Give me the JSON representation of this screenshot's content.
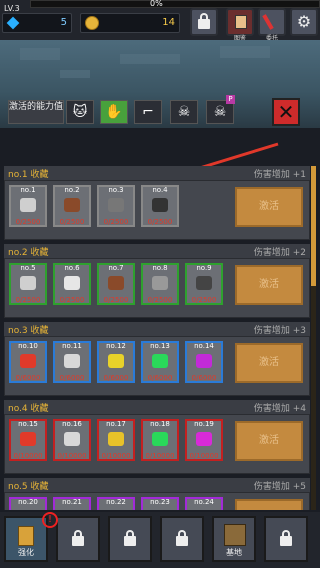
{
  "header": {
    "level": "LV.3",
    "xp_percent_text": "0%",
    "gems": "5",
    "coins": "14",
    "buttons": [
      {
        "label": ""
      },
      {
        "label": "图鉴"
      },
      {
        "label": "委托"
      },
      {
        "label": ""
      }
    ]
  },
  "tabs": {
    "text_tab": "激活的能力值",
    "icons": [
      "cat-icon",
      "hand-icon",
      "gun-icon",
      "skull-icon",
      "skull-p-icon"
    ],
    "p_badge": "P"
  },
  "groups": [
    {
      "name": "no.1 收藏",
      "bonus": "伤害增加 +1",
      "activate": "激活",
      "border_color": "#888",
      "items": [
        {
          "num": "no.1",
          "count": "0/2500",
          "color": "#cfcfcf"
        },
        {
          "num": "no.2",
          "count": "0/2500",
          "color": "#8a4a2a"
        },
        {
          "num": "no.3",
          "count": "0/2500",
          "color": "#777"
        },
        {
          "num": "no.4",
          "count": "0/2500",
          "color": "#333"
        }
      ]
    },
    {
      "name": "no.2 收藏",
      "bonus": "伤害增加 +2",
      "activate": "激活",
      "border_color": "#2ea12e",
      "items": [
        {
          "num": "no.5",
          "count": "0/2500",
          "color": "#cfcfcf"
        },
        {
          "num": "no.6",
          "count": "0/2500",
          "color": "#e6e6e6"
        },
        {
          "num": "no.7",
          "count": "0/2500",
          "color": "#8a4a2a"
        },
        {
          "num": "no.8",
          "count": "0/2500",
          "color": "#999"
        },
        {
          "num": "no.9",
          "count": "0/2500",
          "color": "#444"
        }
      ]
    },
    {
      "name": "no.3 收藏",
      "bonus": "伤害增加 +3",
      "activate": "激活",
      "border_color": "#2a7bd8",
      "items": [
        {
          "num": "no.10",
          "count": "0/6000",
          "color": "#e03a2a"
        },
        {
          "num": "no.11",
          "count": "0/6000",
          "color": "#d8d8d8"
        },
        {
          "num": "no.12",
          "count": "0/6000",
          "color": "#e8d22a"
        },
        {
          "num": "no.13",
          "count": "0/6000",
          "color": "#2ad85a"
        },
        {
          "num": "no.14",
          "count": "0/6000",
          "color": "#c22ad8"
        }
      ]
    },
    {
      "name": "no.4 收藏",
      "bonus": "伤害增加 +4",
      "activate": "激活",
      "border_color": "#c42020",
      "items": [
        {
          "num": "no.15",
          "count": "0/10000",
          "color": "#e03a2a"
        },
        {
          "num": "no.16",
          "count": "0/10000",
          "color": "#d8d8d8"
        },
        {
          "num": "no.17",
          "count": "0/10000",
          "color": "#e8c22a"
        },
        {
          "num": "no.18",
          "count": "0/10000",
          "color": "#2ad85a"
        },
        {
          "num": "no.19",
          "count": "0/10000",
          "color": "#d82ad8"
        }
      ]
    },
    {
      "name": "no.5 收藏",
      "bonus": "伤害增加 +5",
      "activate": "激活",
      "border_color": "#a22ad8",
      "items": [
        {
          "num": "no.20",
          "count": "",
          "color": "#e03a2a"
        },
        {
          "num": "no.21",
          "count": "",
          "color": "#d8d8d8"
        },
        {
          "num": "no.22",
          "count": "",
          "color": "#e8c22a"
        },
        {
          "num": "no.23",
          "count": "",
          "color": "#2ad85a"
        },
        {
          "num": "no.24",
          "count": "",
          "color": "#d82ad8"
        }
      ]
    }
  ],
  "bottom_nav": [
    {
      "label": "强化",
      "icon": "upgrade-icon",
      "selected": true,
      "alert": "!"
    },
    {
      "label": "",
      "icon": "lock-icon",
      "selected": false
    },
    {
      "label": "",
      "icon": "lock-icon",
      "selected": false
    },
    {
      "label": "",
      "icon": "lock-icon",
      "selected": false
    },
    {
      "label": "基地",
      "icon": "base-icon",
      "selected": false
    },
    {
      "label": "",
      "icon": "lock-icon",
      "selected": false
    }
  ],
  "colors": {
    "accent_orange": "#c48a3f",
    "group_title": "#e7b437",
    "close_red": "#ce2b2b"
  }
}
